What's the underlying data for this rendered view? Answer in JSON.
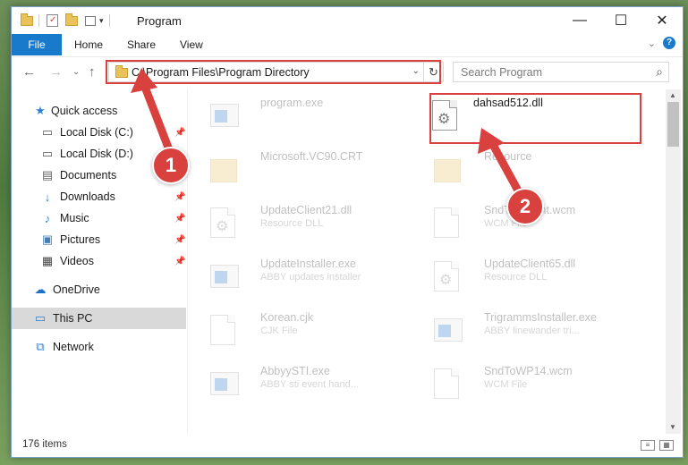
{
  "titlebar": {
    "title": "Program",
    "controls": {
      "minimize": "—",
      "maximize": "☐",
      "close": "✕"
    }
  },
  "ribbon": {
    "tabs": [
      "File",
      "Home",
      "Share",
      "View"
    ],
    "expand_glyph": "⌄",
    "help_glyph": "?"
  },
  "nav": {
    "back_glyph": "←",
    "forward_glyph": "→",
    "recent_glyph": "⌄",
    "up_glyph": "↑",
    "address": "C:\\Program Files\\Program Directory",
    "refresh_glyph": "↻",
    "dropdown_glyph": "⌄",
    "search_placeholder": "Search Program",
    "search_glyph": "⌕"
  },
  "sidebar": {
    "items": [
      {
        "label": "Quick access",
        "icon": "★"
      },
      {
        "label": "Local Disk (C:)",
        "icon": "▭"
      },
      {
        "label": "Local Disk (D:)",
        "icon": "▭"
      },
      {
        "label": "Documents",
        "icon": "▤"
      },
      {
        "label": "Downloads",
        "icon": "↓"
      },
      {
        "label": "Music",
        "icon": "♪"
      },
      {
        "label": "Pictures",
        "icon": "▣"
      },
      {
        "label": "Videos",
        "icon": "▦"
      },
      {
        "label": "OneDrive",
        "icon": "☁"
      },
      {
        "label": "This PC",
        "icon": "▭"
      },
      {
        "label": "Network",
        "icon": "⧉"
      }
    ],
    "pin_glyph": "📌"
  },
  "files": [
    {
      "name": "program.exe",
      "desc": ""
    },
    {
      "name": "dahsad512.dll",
      "desc": ""
    },
    {
      "name": "Microsoft.VC90.CRT",
      "desc": ""
    },
    {
      "name": "Resource",
      "desc": ""
    },
    {
      "name": "UpdateClient21.dll",
      "desc": "Resource DLL"
    },
    {
      "name": "SndToolsFmt.wcm",
      "desc": "WCM File"
    },
    {
      "name": "UpdateInstaller.exe",
      "desc": "ABBY updates installer"
    },
    {
      "name": "UpdateClient65.dll",
      "desc": "Resource DLL"
    },
    {
      "name": "Korean.cjk",
      "desc": "CJK File"
    },
    {
      "name": "TrigrammsInstaller.exe",
      "desc": "ABBY linewander tri..."
    },
    {
      "name": "AbbyySTI.exe",
      "desc": "ABBY sti event hand..."
    },
    {
      "name": "SndToWP14.wcm",
      "desc": "WCM File"
    }
  ],
  "scroll": {
    "up": "▲",
    "down": "▼"
  },
  "status": {
    "count": "176 items",
    "details_glyph": "≡",
    "tiles_glyph": "▦"
  },
  "callouts": {
    "one": "1",
    "two": "2"
  },
  "colors": {
    "accent": "#1979ca",
    "callout": "#d9413f",
    "selected": "#d9d9d9"
  }
}
